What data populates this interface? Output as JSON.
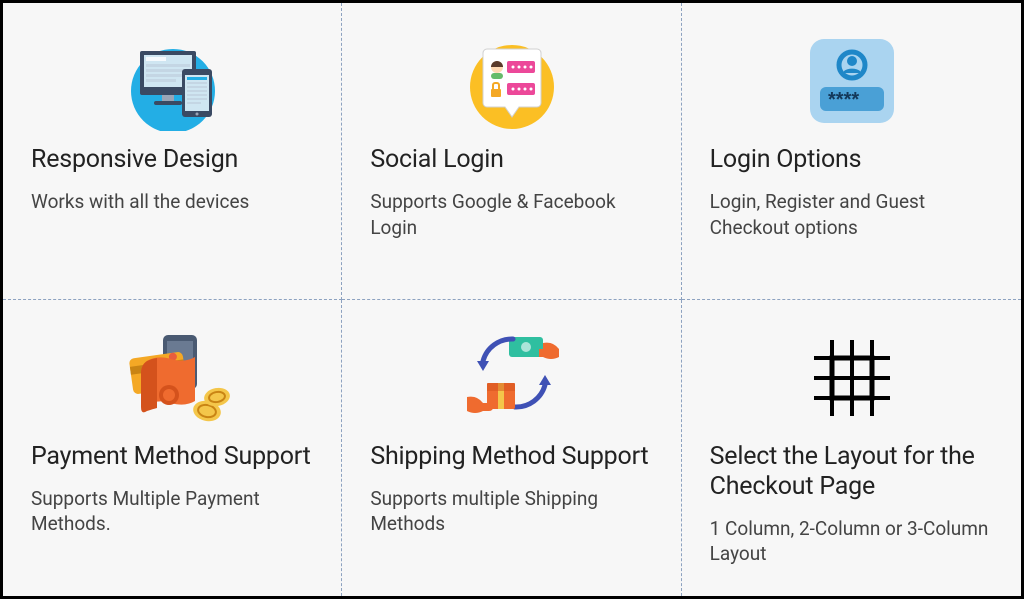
{
  "features": [
    {
      "title": "Responsive Design",
      "desc": "Works with all the devices"
    },
    {
      "title": "Social Login",
      "desc": "Supports Google & Facebook Login"
    },
    {
      "title": "Login Options",
      "desc": "Login, Register and Guest Checkout options"
    },
    {
      "title": "Payment Method Support",
      "desc": "Supports Multiple Payment Methods."
    },
    {
      "title": "Shipping Method Support",
      "desc": "Supports multiple Shipping Methods"
    },
    {
      "title": "Select the Layout for the Checkout Page",
      "desc": "1 Column, 2-Column or 3-Column Layout"
    }
  ]
}
